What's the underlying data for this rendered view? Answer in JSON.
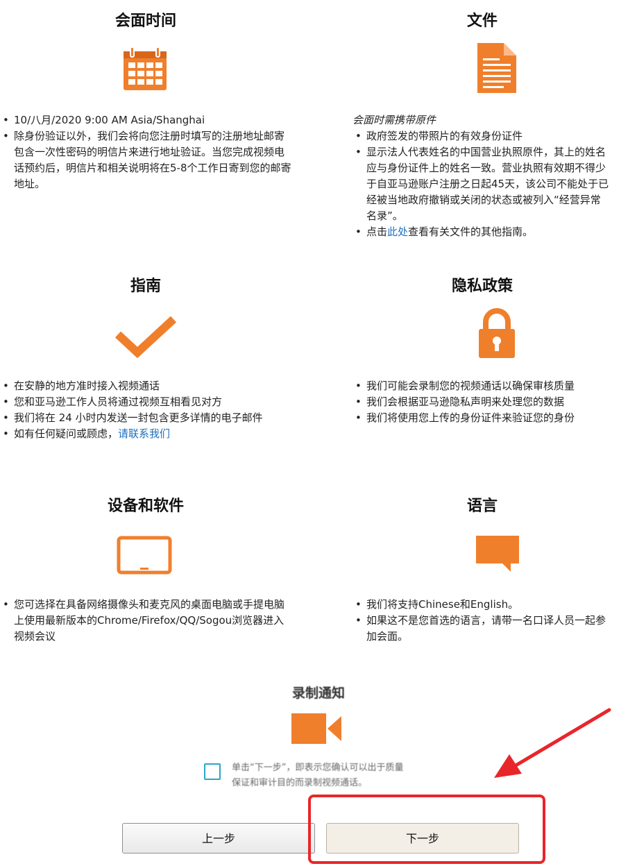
{
  "meeting_time": {
    "title": "会面时间",
    "items": [
      "10/八月/2020 9:00 AM Asia/Shanghai",
      "除身份验证以外，我们会将向您注册时填写的注册地址邮寄包含一次性密码的明信片来进行地址验证。当您完成视频电话预约后，明信片和相关说明将在5-8个工作日寄到您的邮寄地址。"
    ]
  },
  "documents": {
    "title": "文件",
    "intro": "会面时需携带原件",
    "item1": "政府签发的带照片的有效身份证件",
    "item2_lines": [
      "显示法人代表姓名的中国营业执照原件，其上的姓名",
      "应与身份证件上的姓名一致。营业执照有效期不得少",
      "于自亚马逊账户注册之日起45天，该公司不能处于已",
      "经被当地政府撤销或关闭的状态或被列入“经营异常",
      "名录”。"
    ],
    "item3_prefix": "点击",
    "item3_link": "此处",
    "item3_suffix": "查看有关文件的其他指南。"
  },
  "guide": {
    "title": "指南",
    "items": [
      "在安静的地方准时接入视频通话",
      "您和亚马逊工作人员将通过视频互相看见对方",
      "我们将在 24 小时内发送一封包含更多详情的电子邮件"
    ],
    "item4_prefix": "如有任何疑问或顾虑，",
    "item4_link": "请联系我们"
  },
  "privacy": {
    "title": "隐私政策",
    "items": [
      "我们可能会录制您的视频通话以确保审核质量",
      "我们会根据亚马逊隐私声明来处理您的数据",
      "我们将使用您上传的身份证件来验证您的身份"
    ]
  },
  "devices": {
    "title": "设备和软件",
    "items": [
      "您可选择在具备网络摄像头和麦克风的桌面电脑或手提电脑上使用最新版本的Chrome/Firefox/QQ/Sogou浏览器进入视频会议"
    ]
  },
  "language": {
    "title": "语言",
    "items": [
      "我们将支持Chinese和English。",
      "如果这不是您首选的语言，请带一名口译人员一起参加会面。"
    ],
    "item2_lines": [
      "如果这不是您首选的语言，请带一名口译人员一起参",
      "加会面。"
    ]
  },
  "recording": {
    "title": "录制通知",
    "consent_lines": [
      "单击“下一步”，即表示您确认可以出于质量",
      "保证和审计目的而录制视频通话。"
    ]
  },
  "buttons": {
    "prev": "上一步",
    "next": "下一步"
  },
  "colors": {
    "icon_orange": "#f07f2c",
    "link_blue": "#1f6fbf",
    "highlight_red": "#e8262a"
  }
}
